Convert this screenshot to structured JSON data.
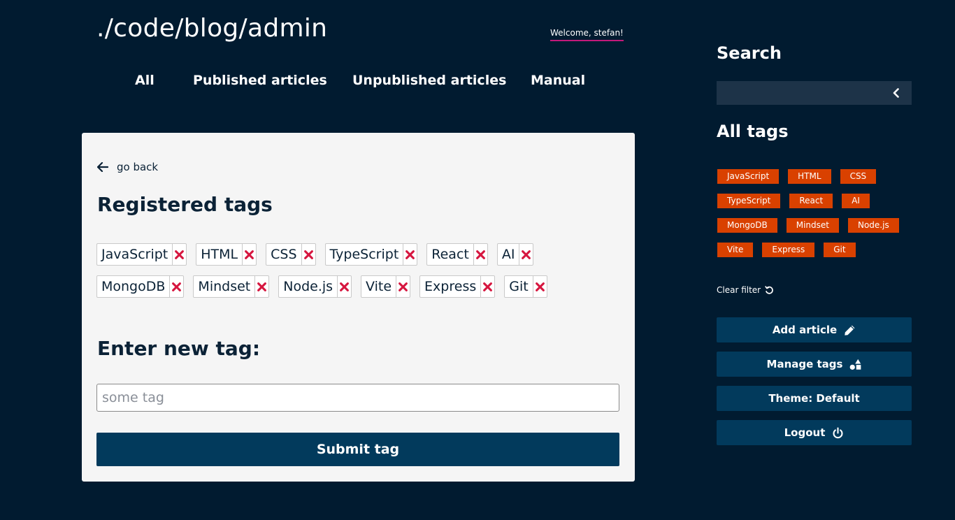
{
  "header": {
    "site_title": "./code/blog/admin",
    "welcome": "Welcome, stefan!"
  },
  "nav": {
    "all": "All",
    "published": "Published articles",
    "unpublished": "Unpublished articles",
    "manual": "Manual"
  },
  "main": {
    "go_back": "go back",
    "registered_heading": "Registered tags",
    "registered_tags": [
      "JavaScript",
      "HTML",
      "CSS",
      "TypeScript",
      "React",
      "AI",
      "MongoDB",
      "Mindset",
      "Node.js",
      "Vite",
      "Express",
      "Git"
    ],
    "enter_heading": "Enter new tag:",
    "input_placeholder": "some tag",
    "input_value": "",
    "submit_label": "Submit tag"
  },
  "sidebar": {
    "search_heading": "Search",
    "search_value": "",
    "all_tags_heading": "All tags",
    "filter_tags": [
      "JavaScript",
      "HTML",
      "CSS",
      "TypeScript",
      "React",
      "AI",
      "MongoDB",
      "Mindset",
      "Node.js",
      "Vite",
      "Express",
      "Git"
    ],
    "clear_filter": "Clear filter",
    "add_article": "Add article",
    "manage_tags": "Manage tags",
    "theme": "Theme: Default",
    "logout": "Logout"
  },
  "icons": {
    "back": "arrow-left-icon",
    "remove": "close-icon",
    "search_toggle": "chevron-left-icon",
    "clear": "undo-icon",
    "add": "pencil-icon",
    "manage": "shapes-icon",
    "logout": "power-icon"
  },
  "colors": {
    "background": "#011b30",
    "card": "#f5f5f5",
    "primary_button": "#023a5c",
    "tag_accent": "#d94100",
    "remove_icon": "#d6163f",
    "welcome_underline": "#c2197a"
  }
}
